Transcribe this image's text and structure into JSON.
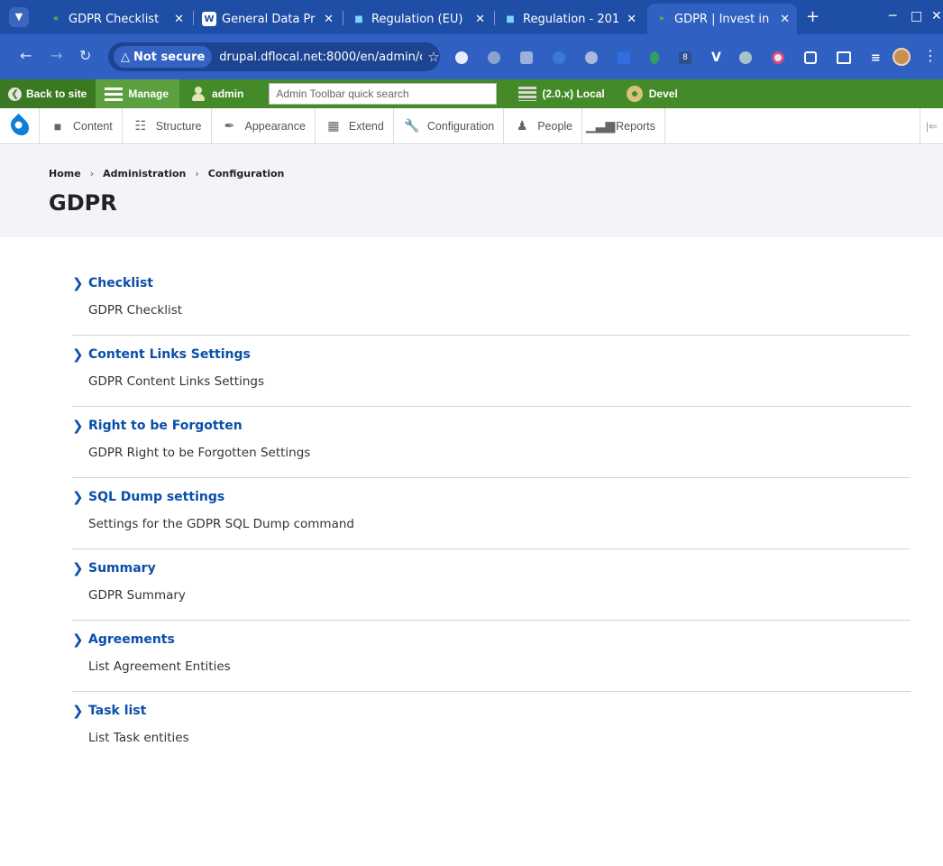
{
  "browser": {
    "tabs": [
      {
        "title": "GDPR Checklist",
        "favicon": "drupal-icon"
      },
      {
        "title": "General Data Pr",
        "favicon": "wikipedia-icon"
      },
      {
        "title": "Regulation (EU)",
        "favicon": "chat-icon"
      },
      {
        "title": "Regulation - 201",
        "favicon": "chat-icon"
      },
      {
        "title": "GDPR | Invest in",
        "favicon": "drupal-icon",
        "active": true
      }
    ],
    "security_label": "Not secure",
    "url": "drupal.dflocal.net:8000/en/admin/c…",
    "extension_badge": "8"
  },
  "toolbar": {
    "back_label": "Back to site",
    "manage_label": "Manage",
    "user_label": "admin",
    "search_placeholder": "Admin Toolbar quick search",
    "env_label": "(2.0.x) Local",
    "devel_label": "Devel"
  },
  "tray": {
    "items": [
      {
        "label": "Content",
        "icon": "page-icon"
      },
      {
        "label": "Structure",
        "icon": "sitemap-icon"
      },
      {
        "label": "Appearance",
        "icon": "brush-icon"
      },
      {
        "label": "Extend",
        "icon": "puzzle-icon"
      },
      {
        "label": "Configuration",
        "icon": "wrench-icon"
      },
      {
        "label": "People",
        "icon": "people-icon"
      },
      {
        "label": "Reports",
        "icon": "bar-chart-icon"
      }
    ]
  },
  "breadcrumb": [
    "Home",
    "Administration",
    "Configuration"
  ],
  "page_title": "GDPR",
  "admin_items": [
    {
      "title": "Checklist",
      "description": "GDPR Checklist"
    },
    {
      "title": "Content Links Settings",
      "description": "GDPR Content Links Settings"
    },
    {
      "title": "Right to be Forgotten",
      "description": "GDPR Right to be Forgotten Settings"
    },
    {
      "title": "SQL Dump settings",
      "description": "Settings for the GDPR SQL Dump command"
    },
    {
      "title": "Summary",
      "description": "GDPR Summary"
    },
    {
      "title": "Agreements",
      "description": "List Agreement Entities"
    },
    {
      "title": "Task list",
      "description": "List Task entities"
    }
  ],
  "colors": {
    "toolbar_green": "#448a29",
    "link_blue": "#0a4fa8",
    "browser_blue": "#1f4ea6"
  }
}
